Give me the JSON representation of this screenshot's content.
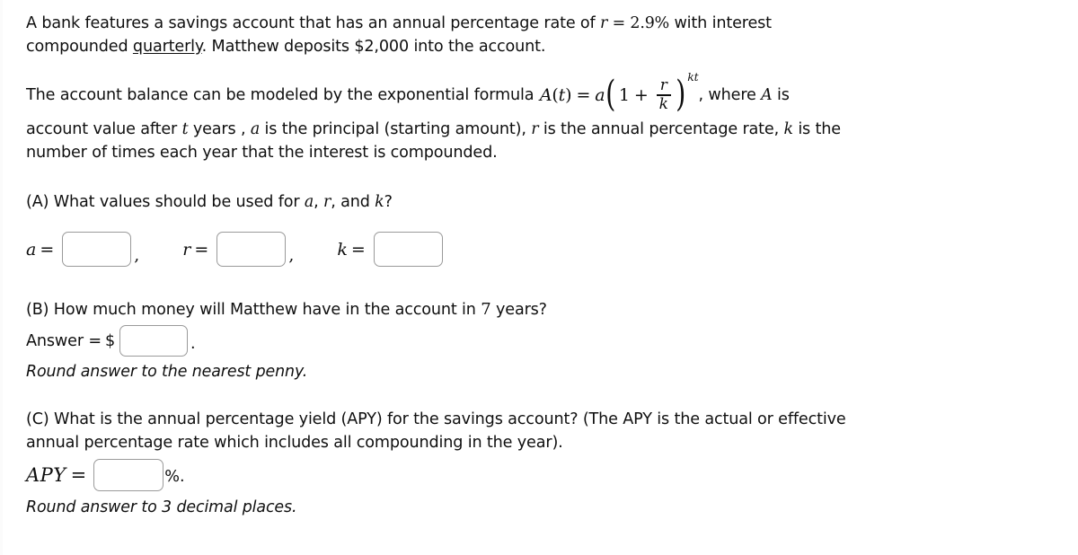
{
  "problem": {
    "intro": {
      "line1_pre": "A bank features a savings account that has an annual percentage rate of ",
      "rate_var": "r",
      "rate_eq": "=",
      "rate_value": "2.9%",
      "line1_post": " with interest",
      "line2_pre": "compounded ",
      "line2_underlined": "quarterly",
      "line2_post": ". Matthew deposits $2,000 into the account."
    },
    "formula_sentence": {
      "lead": "The account balance can be modeled by the exponential formula ",
      "formula": {
        "function_name": "A",
        "open_paren": "(",
        "argument": "t",
        "close_paren": ")",
        "equals": "=",
        "coefficient": "a",
        "one": "1",
        "plus": "+",
        "fraction_numerator": "r",
        "fraction_denominator": "k",
        "exponent": "kt"
      },
      "trail_comma": ", where ",
      "trail_var": "A",
      "trail_end": " is"
    },
    "variable_description": {
      "seg1": "account value after ",
      "var_t": "t",
      "seg2": " years , ",
      "var_a": "a",
      "seg3": " is the principal (starting amount), ",
      "var_r": "r",
      "seg4": " is the annual percentage rate, ",
      "var_k": "k",
      "seg5": " is the",
      "line2": "number of times each year that the interest is compounded."
    },
    "part_a": {
      "question_pre": "(A) What values should be used for ",
      "var_a": "a",
      "sep1": ", ",
      "var_r": "r",
      "sep2": ", and ",
      "var_k": "k",
      "question_post": "?",
      "fields": [
        {
          "label": "a",
          "equals": "=",
          "value": "",
          "placeholder": "",
          "trailing": ","
        },
        {
          "label": "r",
          "equals": "=",
          "value": "",
          "placeholder": "",
          "trailing": ","
        },
        {
          "label": "k",
          "equals": "=",
          "value": "",
          "placeholder": "",
          "trailing": ""
        }
      ]
    },
    "part_b": {
      "question_pre": "(B) How much money will Matthew have in the account in ",
      "years": "7",
      "question_post": " years?",
      "answer_label": "Answer =",
      "currency_symbol": "$",
      "answer_value": "",
      "answer_placeholder": "",
      "period": ".",
      "round_note": "Round answer to the nearest penny."
    },
    "part_c": {
      "question_line1": "(C) What is the annual percentage yield (APY) for the savings account? (The APY is the actual or effective",
      "question_line2": "annual percentage rate which includes all compounding in the year).",
      "apy_label": "APY",
      "equals": "=",
      "apy_value": "",
      "apy_placeholder": "",
      "percent_suffix": "%.",
      "round_note": "Round answer to 3 decimal places."
    }
  },
  "colors": {
    "background": "#ffffff",
    "text": "#0f0f0f",
    "input_border": "#9a9a9a"
  }
}
